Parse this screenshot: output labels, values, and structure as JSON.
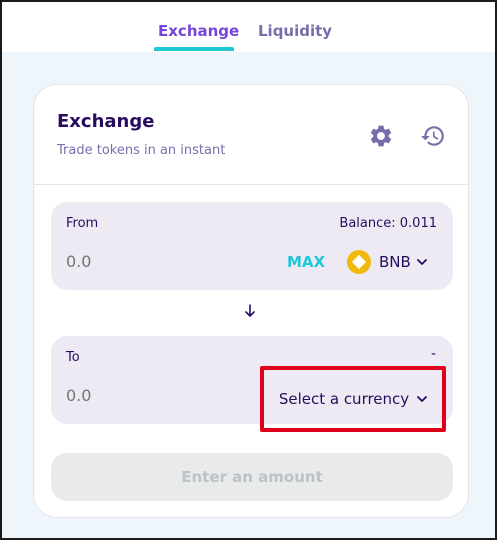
{
  "nav": {
    "tabs": [
      {
        "label": "Exchange",
        "active": true
      },
      {
        "label": "Liquidity",
        "active": false
      }
    ]
  },
  "card": {
    "title": "Exchange",
    "subtitle": "Trade tokens in an instant",
    "icons": {
      "settings": "gear-icon",
      "history": "history-icon"
    }
  },
  "from": {
    "label": "From",
    "balance": "Balance: 0.011",
    "amount_placeholder": "0.0",
    "max_label": "MAX",
    "token": "BNB"
  },
  "to": {
    "label": "To",
    "dash": "-",
    "amount_placeholder": "0.0",
    "select_label": "Select a currency"
  },
  "action": {
    "button_label": "Enter an amount"
  },
  "colors": {
    "accent": "#7645d9",
    "primary_text": "#280d5f",
    "secondary_text": "#7a6eaa",
    "teal": "#1fc7d4",
    "highlight_box": "#e0001b",
    "bnb": "#f0b90b"
  }
}
